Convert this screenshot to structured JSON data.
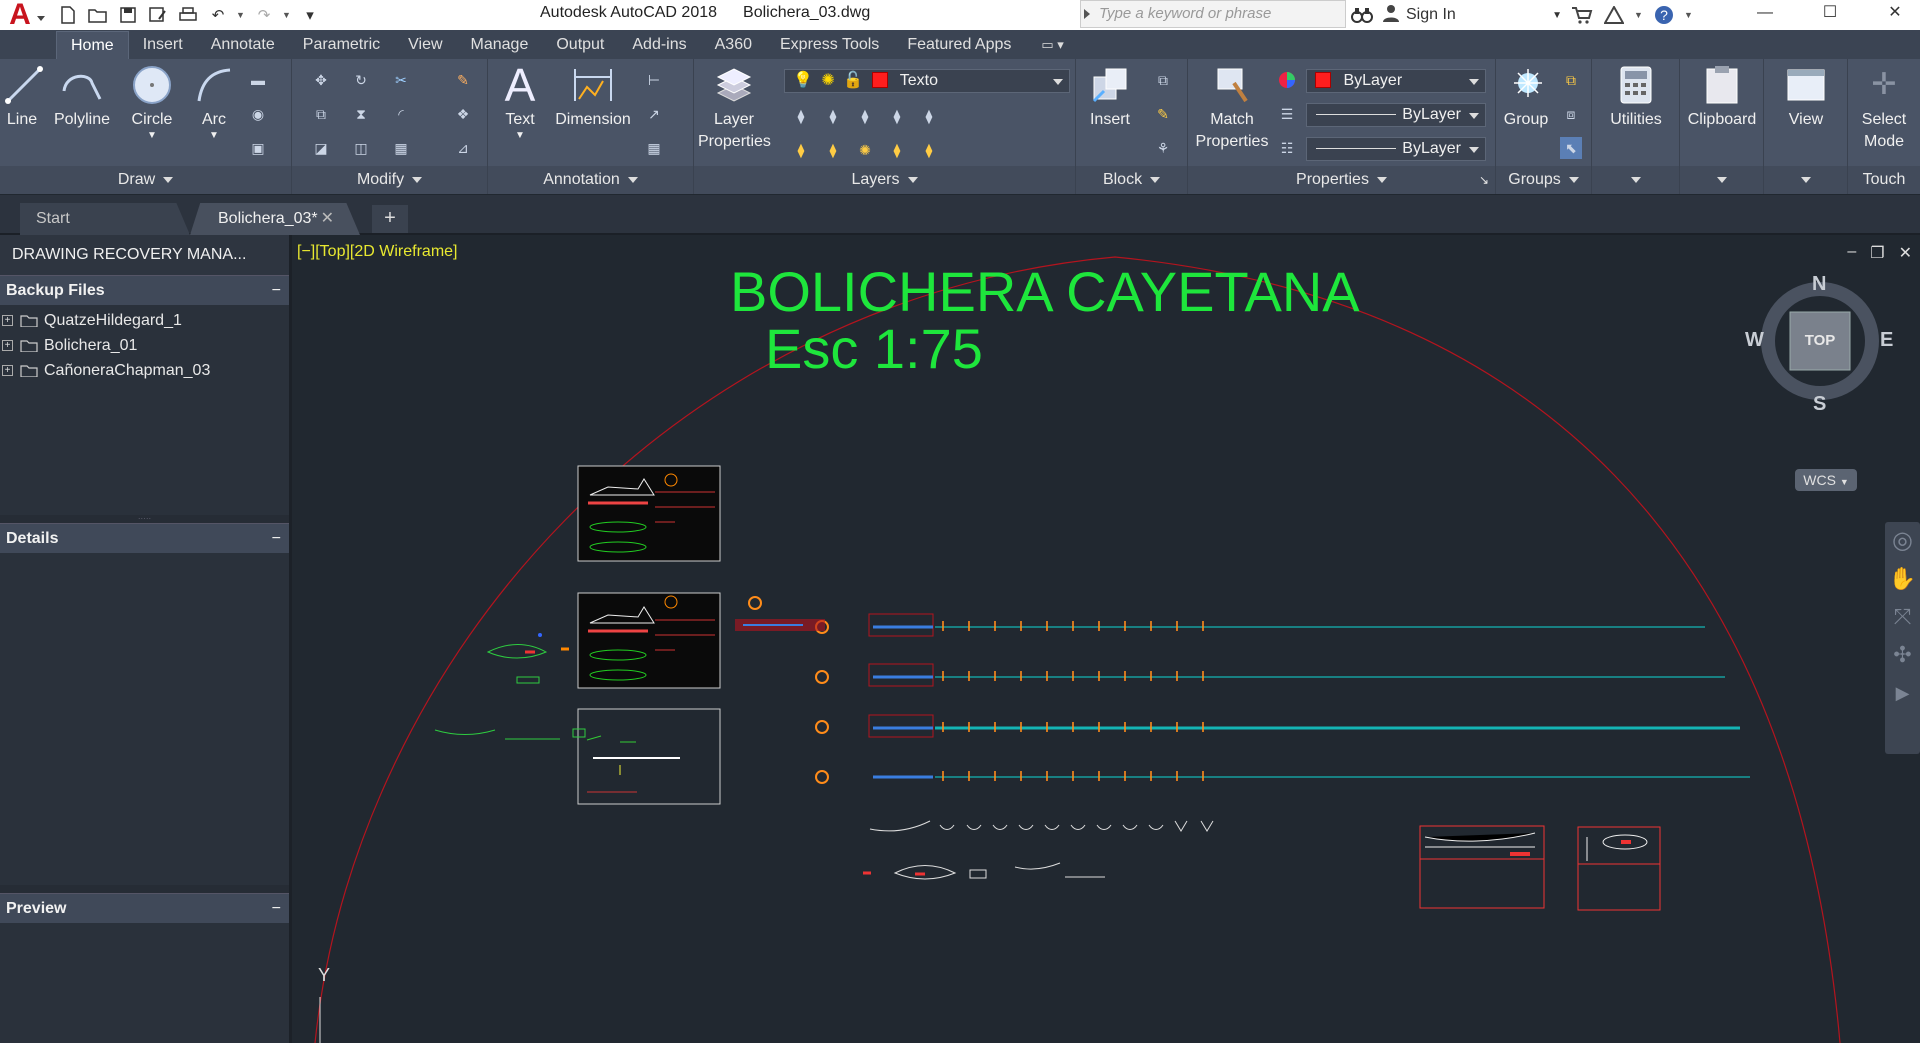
{
  "app": {
    "logo_letter": "A",
    "title": "Autodesk AutoCAD 2018",
    "filename": "Bolichera_03.dwg",
    "search_placeholder": "Type a keyword or phrase",
    "sign_in": "Sign In"
  },
  "ribbon_tabs": [
    "Home",
    "Insert",
    "Annotate",
    "Parametric",
    "View",
    "Manage",
    "Output",
    "Add-ins",
    "A360",
    "Express Tools",
    "Featured Apps"
  ],
  "ribbon": {
    "draw": {
      "title": "Draw",
      "line": "Line",
      "polyline": "Polyline",
      "circle": "Circle",
      "arc": "Arc"
    },
    "modify": {
      "title": "Modify"
    },
    "annotation": {
      "title": "Annotation",
      "text": "Text",
      "dimension": "Dimension"
    },
    "layers": {
      "title": "Layers",
      "layer_properties_1": "Layer",
      "layer_properties_2": "Properties",
      "current_layer": "Texto"
    },
    "block": {
      "title": "Block",
      "insert": "Insert"
    },
    "properties": {
      "title": "Properties",
      "match_1": "Match",
      "match_2": "Properties",
      "color": "ByLayer",
      "linetype": "ByLayer",
      "lineweight": "ByLayer"
    },
    "groups": {
      "title": "Groups",
      "group": "Group"
    },
    "utilities": {
      "label": "Utilities"
    },
    "clipboard": {
      "label": "Clipboard"
    },
    "view": {
      "label": "View"
    },
    "touch": {
      "select_1": "Select",
      "select_2": "Mode",
      "title": "Touch"
    }
  },
  "file_tabs": {
    "start": "Start",
    "doc": "Bolichera_03*"
  },
  "palette": {
    "title": "DRAWING RECOVERY MANA...",
    "backup_header": "Backup Files",
    "backup_files": [
      "QuatzeHildegard_1",
      "Bolichera_01",
      "CañoneraChapman_03"
    ],
    "details_header": "Details",
    "preview_header": "Preview"
  },
  "viewport": {
    "label": "[−][Top][2D Wireframe]",
    "drawing_title": "BOLICHERA CAYETANA",
    "drawing_scale": "Esc 1:75",
    "compass": {
      "n": "N",
      "s": "S",
      "e": "E",
      "w": "W",
      "top": "TOP"
    },
    "wcs": "WCS",
    "ucs_y": "Y"
  },
  "colors": {
    "accent_green": "#1ee63c",
    "boundary_red": "#b4141e",
    "cyan_line": "#14b4b4",
    "orange": "#ff8c1a",
    "vp_label": "#e8e830"
  }
}
